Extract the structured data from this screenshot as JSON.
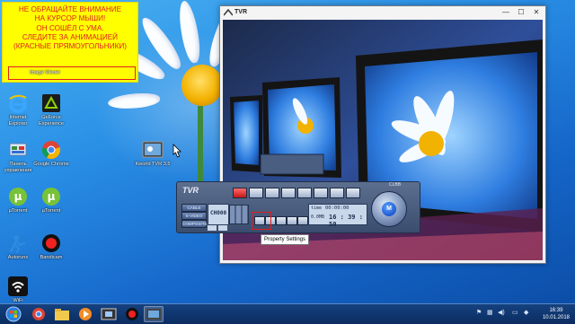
{
  "annotation": {
    "lines": [
      "НЕ ОБРАЩАЙТЕ ВНИМАНИЕ",
      "НА КУРСОР МЫШИ!",
      "ОН СОШЁЛ С УМА.",
      "СЛЕДИТЕ ЗА АНИМАЦИЕЙ",
      "(КРАСНЫЕ ПРЯМОУГОЛЬНИКИ)"
    ],
    "color": "#e02020",
    "background": "#ffff00"
  },
  "desktop_icons": [
    {
      "label": "Image Viewer",
      "icon": "image-viewer-icon"
    },
    {
      "label": "Internet Explorer",
      "icon": "internet-explorer-icon"
    },
    {
      "label": "GeForce Experience",
      "icon": "geforce-icon"
    },
    {
      "label": "Панель управления",
      "icon": "control-panel-icon"
    },
    {
      "label": "Google Chrome",
      "icon": "chrome-icon"
    },
    {
      "label": "Kworld TVR 3.5",
      "icon": "tvr-app-icon"
    },
    {
      "label": "µTorrent",
      "icon": "utorrent-icon"
    },
    {
      "label": "µTorrent",
      "icon": "utorrent-icon"
    },
    {
      "label": "Autoruns",
      "icon": "autoruns-icon"
    },
    {
      "label": "Bandicam",
      "icon": "bandicam-icon"
    },
    {
      "label": "WiFi",
      "icon": "wifi-icon"
    }
  ],
  "window": {
    "title": "TVR",
    "controls": {
      "minimize": "—",
      "maximize": "☐",
      "close": "✕"
    }
  },
  "tvr_panel": {
    "logo": "TVR",
    "source_buttons": [
      "CABLE",
      "S-VIDEO",
      "COMPOSITE"
    ],
    "channel": "CH000",
    "time_label": "time",
    "time_top": "00:00:00",
    "size": "0.0MB",
    "time_big": "16 : 39 : 50",
    "knob_label": "M",
    "brand": "CLBB"
  },
  "tooltip": "Property Settings",
  "taskbar": {
    "items": [
      {
        "icon": "start-icon",
        "active": false
      },
      {
        "icon": "chrome-icon",
        "active": false
      },
      {
        "icon": "folder-icon",
        "active": false
      },
      {
        "icon": "media-player-icon",
        "active": false
      },
      {
        "icon": "film-icon",
        "active": false
      },
      {
        "icon": "bandicam-icon",
        "active": false
      },
      {
        "icon": "tvr-app-icon",
        "active": true
      }
    ],
    "clock_time": "16:39",
    "clock_date": "10.01.2018"
  }
}
